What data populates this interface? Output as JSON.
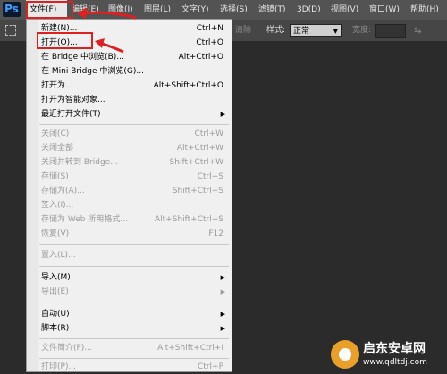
{
  "app": {
    "logo": "Ps"
  },
  "menubar": {
    "items": [
      {
        "label": "文件(F)"
      },
      {
        "label": "编辑(E)"
      },
      {
        "label": "图像(I)"
      },
      {
        "label": "图层(L)"
      },
      {
        "label": "文字(Y)"
      },
      {
        "label": "选择(S)"
      },
      {
        "label": "滤镜(T)"
      },
      {
        "label": "3D(D)"
      },
      {
        "label": "视图(V)"
      },
      {
        "label": "窗口(W)"
      },
      {
        "label": "帮助(H)"
      }
    ]
  },
  "options": {
    "partial_label": "清除",
    "style_label": "样式:",
    "style_value": "正常",
    "width_label": "宽度:"
  },
  "menu": {
    "new": {
      "label": "新建(N)...",
      "shortcut": "Ctrl+N"
    },
    "open": {
      "label": "打开(O)...",
      "shortcut": "Ctrl+O"
    },
    "browse_bridge": {
      "label": "在 Bridge 中浏览(B)...",
      "shortcut": "Alt+Ctrl+O"
    },
    "browse_mini_bridge": {
      "label": "在 Mini Bridge 中浏览(G)..."
    },
    "open_as": {
      "label": "打开为...",
      "shortcut": "Alt+Shift+Ctrl+O"
    },
    "open_smart": {
      "label": "打开为智能对象..."
    },
    "recent": {
      "label": "最近打开文件(T)"
    },
    "close": {
      "label": "关闭(C)",
      "shortcut": "Ctrl+W"
    },
    "close_all": {
      "label": "关闭全部",
      "shortcut": "Alt+Ctrl+W"
    },
    "close_bridge": {
      "label": "关闭并转到 Bridge...",
      "shortcut": "Shift+Ctrl+W"
    },
    "save": {
      "label": "存储(S)",
      "shortcut": "Ctrl+S"
    },
    "save_as": {
      "label": "存储为(A)...",
      "shortcut": "Shift+Ctrl+S"
    },
    "check_in": {
      "label": "签入(I)..."
    },
    "save_web": {
      "label": "存储为 Web 所用格式...",
      "shortcut": "Alt+Shift+Ctrl+S"
    },
    "revert": {
      "label": "恢复(V)",
      "shortcut": "F12"
    },
    "place": {
      "label": "置入(L)..."
    },
    "import": {
      "label": "导入(M)"
    },
    "export": {
      "label": "导出(E)"
    },
    "automate": {
      "label": "自动(U)"
    },
    "scripts": {
      "label": "脚本(R)"
    },
    "file_info": {
      "label": "文件简介(F)...",
      "shortcut": "Alt+Shift+Ctrl+I"
    },
    "print": {
      "label": "打印(P)...",
      "shortcut": "Ctrl+P"
    }
  },
  "watermark": {
    "name": "启东安卓网",
    "url": "www.qdltdj.com"
  }
}
